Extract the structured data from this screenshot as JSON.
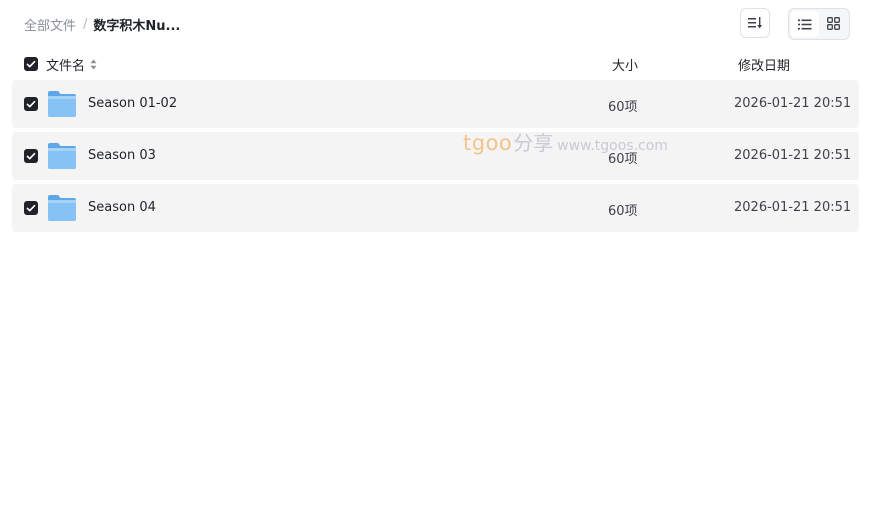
{
  "breadcrumb": {
    "root": "全部文件",
    "separator": "/",
    "current": "数字积木Nu..."
  },
  "toolbar": {
    "sort_icon": "sort-descending-icon",
    "list_view_icon": "list-view-icon",
    "grid_view_icon": "grid-view-icon",
    "active_view": "list"
  },
  "columns": {
    "name": "文件名",
    "size": "大小",
    "date": "修改日期"
  },
  "files": [
    {
      "name": "Season 01-02",
      "size": "60项",
      "date": "2026-01-21 20:51",
      "checked": true,
      "icon": "folder-icon"
    },
    {
      "name": "Season 03",
      "size": "60项",
      "date": "2026-01-21 20:51",
      "checked": true,
      "icon": "folder-icon"
    },
    {
      "name": "Season 04",
      "size": "60项",
      "date": "2026-01-21 20:51",
      "checked": true,
      "icon": "folder-icon"
    }
  ],
  "watermark": {
    "brand": "tgoo",
    "cn": "分享",
    "url": "www.tgoos.com"
  },
  "colors": {
    "row_bg": "#f4f4f5",
    "checkbox": "#1f2329",
    "folder": "#7cbcf2",
    "watermark_brand": "#f3c48a"
  }
}
